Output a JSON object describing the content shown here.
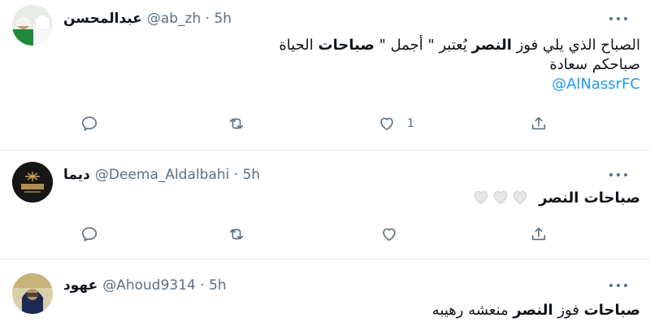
{
  "tweets": [
    {
      "name": "عبدالمحسن",
      "handle": "@ab_zh",
      "dot": "·",
      "time": "5h",
      "line1_part1": "الصباح الذي يلي فوز ",
      "line1_bold1": "النصر",
      "line1_part2": " يُعتبر \" أجمل \" ",
      "line1_bold2": "صباحات",
      "line1_part3": " الحياة",
      "line2": "صباحكم سعادة",
      "mention": "@AlNassrFC",
      "like_count": "1",
      "icons": [
        "reply-icon",
        "retweet-icon",
        "like-icon",
        "share-icon"
      ]
    },
    {
      "name": "ديما",
      "handle": "@Deema_Aldalbahi",
      "dot": "·",
      "time": "5h",
      "text": "صباحات النصر",
      "emoji_icons": [
        "white-heart-icon",
        "white-heart-icon",
        "white-heart-icon"
      ],
      "icons": [
        "reply-icon",
        "retweet-icon",
        "like-icon",
        "share-icon"
      ]
    },
    {
      "name": "عهود",
      "handle": "@Ahoud9314",
      "dot": "·",
      "time": "5h",
      "bold1": "صباحات",
      "part1": " فوز ",
      "bold2": "النصر",
      "part2": " منعشه رهيبه"
    }
  ],
  "colors": {
    "accent": "#1d9bf0",
    "muted": "#5b7083",
    "divider": "#e3e6e9"
  }
}
